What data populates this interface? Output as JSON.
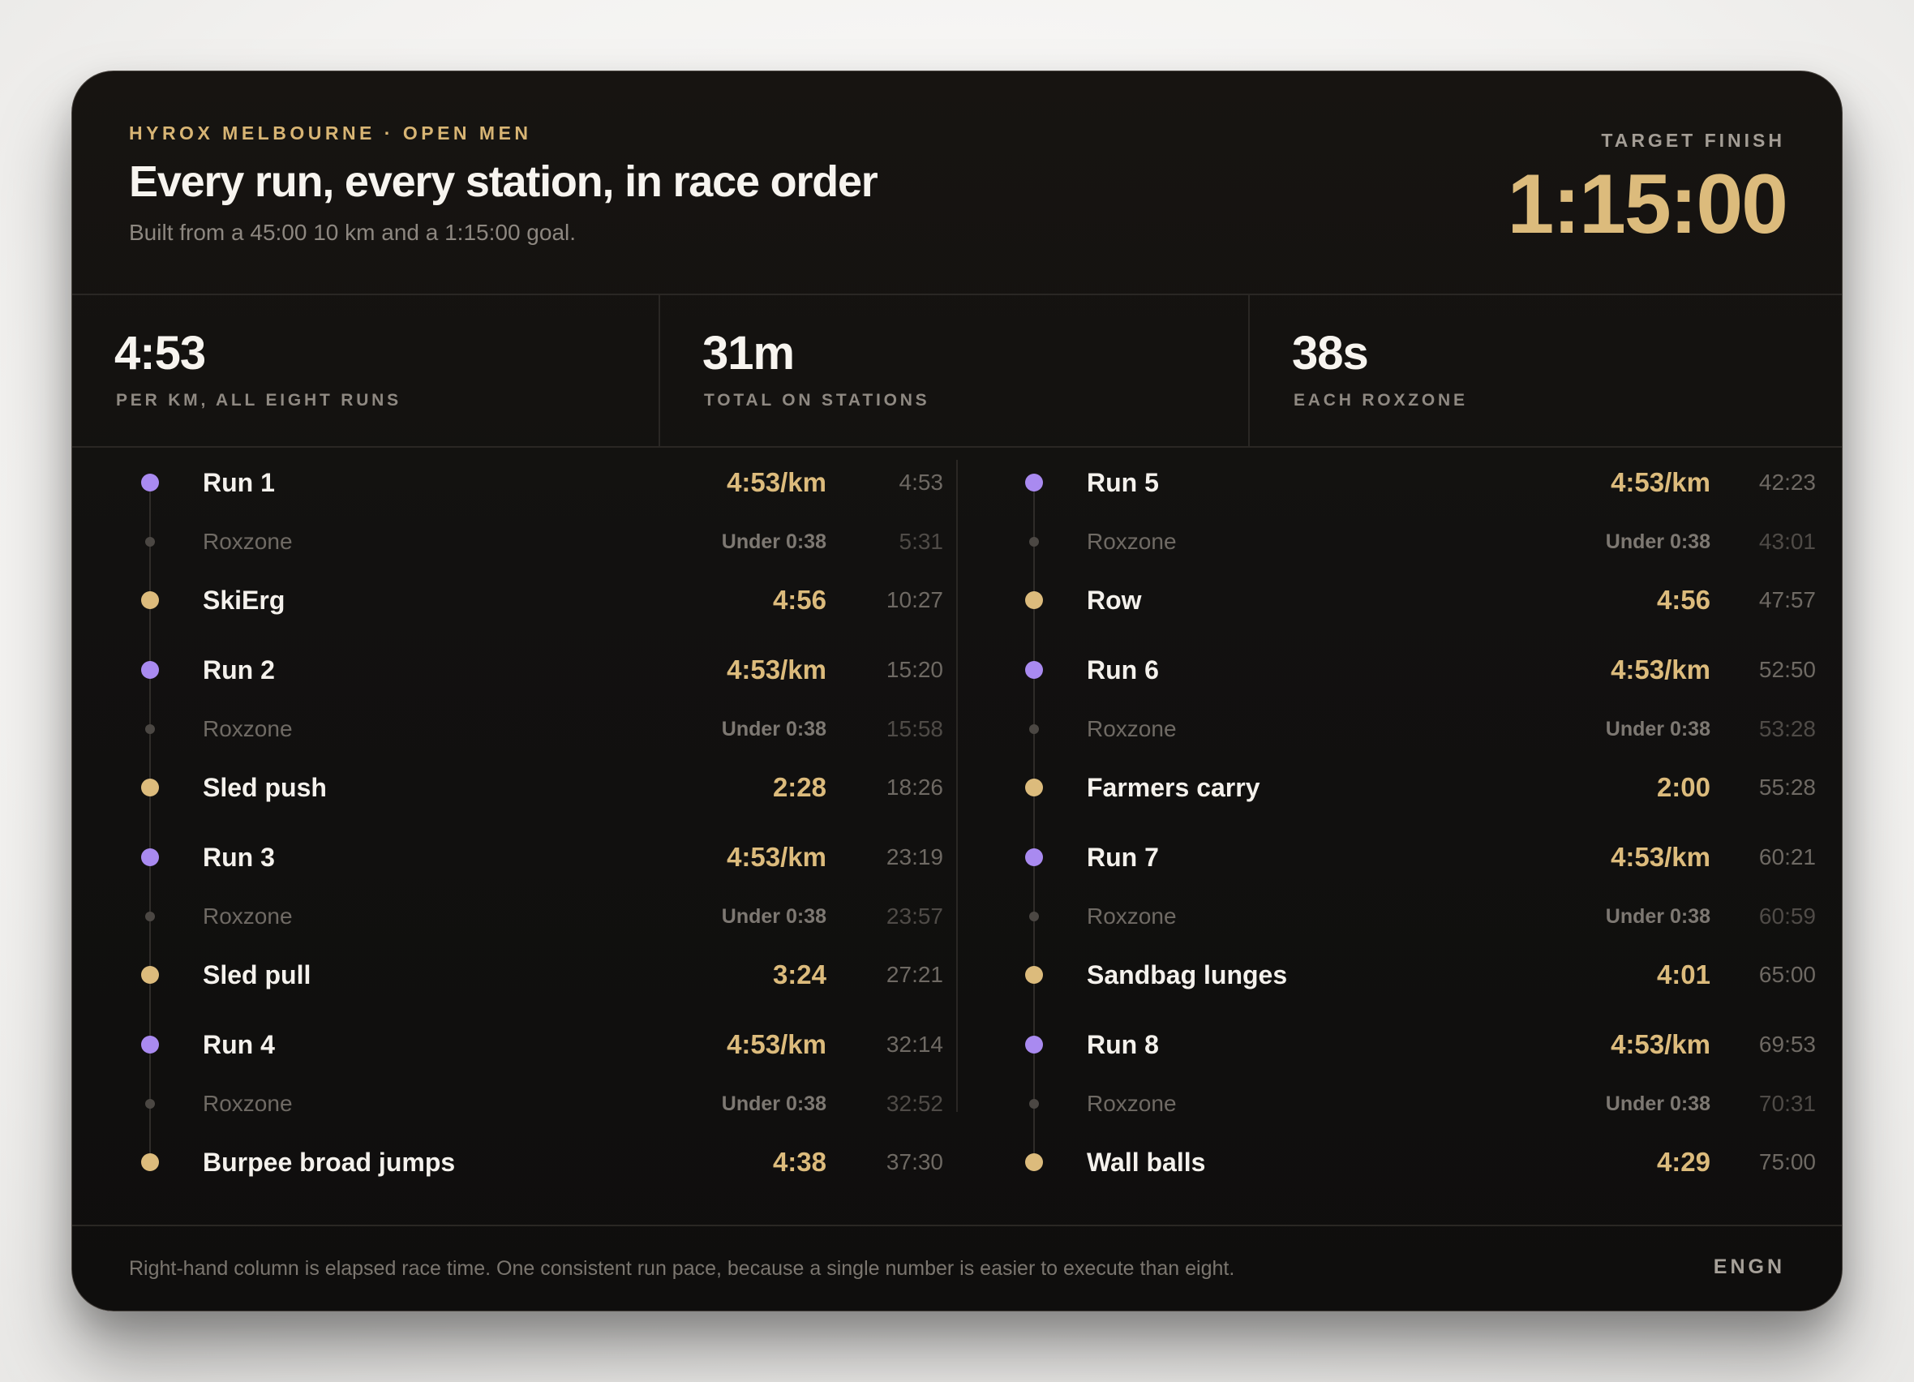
{
  "header": {
    "eyebrow": "HYROX MELBOURNE · OPEN MEN",
    "title": "Every run, every station, in race order",
    "subtitle": "Built from a 45:00 10 km and a 1:15:00 goal.",
    "target_label": "TARGET FINISH",
    "target_value": "1:15:00"
  },
  "stats": [
    {
      "value": "4:53",
      "label": "PER KM, ALL EIGHT RUNS"
    },
    {
      "value": "31m",
      "label": "TOTAL ON STATIONS"
    },
    {
      "value": "38s",
      "label": "EACH ROXZONE"
    }
  ],
  "timeline": {
    "left": [
      {
        "kind": "run",
        "name": "Run 1",
        "split": "4:53/km",
        "elapsed": "4:53"
      },
      {
        "kind": "zone",
        "name": "Roxzone",
        "split": "Under 0:38",
        "elapsed": "5:31"
      },
      {
        "kind": "station",
        "name": "SkiErg",
        "split": "4:56",
        "elapsed": "10:27"
      },
      {
        "kind": "run",
        "name": "Run 2",
        "split": "4:53/km",
        "elapsed": "15:20"
      },
      {
        "kind": "zone",
        "name": "Roxzone",
        "split": "Under 0:38",
        "elapsed": "15:58"
      },
      {
        "kind": "station",
        "name": "Sled push",
        "split": "2:28",
        "elapsed": "18:26"
      },
      {
        "kind": "run",
        "name": "Run 3",
        "split": "4:53/km",
        "elapsed": "23:19"
      },
      {
        "kind": "zone",
        "name": "Roxzone",
        "split": "Under 0:38",
        "elapsed": "23:57"
      },
      {
        "kind": "station",
        "name": "Sled pull",
        "split": "3:24",
        "elapsed": "27:21"
      },
      {
        "kind": "run",
        "name": "Run 4",
        "split": "4:53/km",
        "elapsed": "32:14"
      },
      {
        "kind": "zone",
        "name": "Roxzone",
        "split": "Under 0:38",
        "elapsed": "32:52"
      },
      {
        "kind": "station",
        "name": "Burpee broad jumps",
        "split": "4:38",
        "elapsed": "37:30"
      }
    ],
    "right": [
      {
        "kind": "run",
        "name": "Run 5",
        "split": "4:53/km",
        "elapsed": "42:23"
      },
      {
        "kind": "zone",
        "name": "Roxzone",
        "split": "Under 0:38",
        "elapsed": "43:01"
      },
      {
        "kind": "station",
        "name": "Row",
        "split": "4:56",
        "elapsed": "47:57"
      },
      {
        "kind": "run",
        "name": "Run 6",
        "split": "4:53/km",
        "elapsed": "52:50"
      },
      {
        "kind": "zone",
        "name": "Roxzone",
        "split": "Under 0:38",
        "elapsed": "53:28"
      },
      {
        "kind": "station",
        "name": "Farmers carry",
        "split": "2:00",
        "elapsed": "55:28"
      },
      {
        "kind": "run",
        "name": "Run 7",
        "split": "4:53/km",
        "elapsed": "60:21"
      },
      {
        "kind": "zone",
        "name": "Roxzone",
        "split": "Under 0:38",
        "elapsed": "60:59"
      },
      {
        "kind": "station",
        "name": "Sandbag lunges",
        "split": "4:01",
        "elapsed": "65:00"
      },
      {
        "kind": "run",
        "name": "Run 8",
        "split": "4:53/km",
        "elapsed": "69:53"
      },
      {
        "kind": "zone",
        "name": "Roxzone",
        "split": "Under 0:38",
        "elapsed": "70:31"
      },
      {
        "kind": "station",
        "name": "Wall balls",
        "split": "4:29",
        "elapsed": "75:00"
      }
    ]
  },
  "footer": {
    "note": "Right-hand column is elapsed race time. One consistent run pace, because a single number is easier to execute than eight.",
    "brand": "ENGN"
  },
  "colors": {
    "accent_gold": "#dcbb7c",
    "run_purple": "#a98af0",
    "background": "#121110"
  }
}
